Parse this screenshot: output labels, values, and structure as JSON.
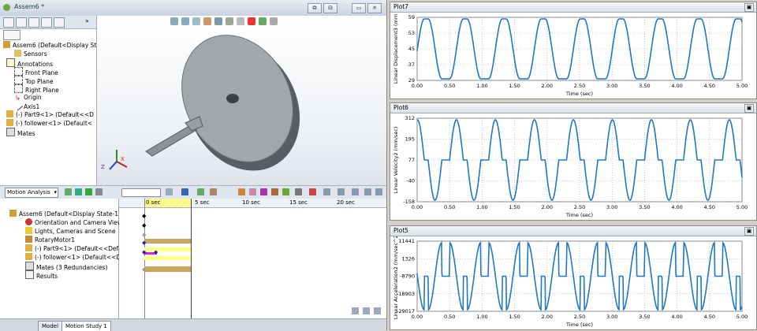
{
  "window": {
    "title": "Assem6 *",
    "btn_restore": "⧉",
    "btn_tile": "⊟",
    "btn_min": "▭",
    "btn_close": "✕",
    "pane_close": "▣"
  },
  "tree": {
    "root": "Assem6  (Default<Display State-",
    "items": [
      "Sensors",
      "Annotations",
      "Front Plane",
      "Top Plane",
      "Right Plane",
      "Origin",
      "Axis1",
      "(-) Part9<1> (Default<<D",
      "(-) follower<1> (Default<",
      "Mates"
    ]
  },
  "motion": {
    "study_type": "Motion Analysis",
    "ruler": [
      "0 sec",
      "5 sec",
      "10 sec",
      "15 sec",
      "20 sec"
    ],
    "tree": [
      "Assem6  (Default<Display State-1",
      "Orientation and Camera Views",
      "Lights, Cameras and Scene",
      "RotaryMotor1",
      "(-) Part9<1> (Default<<Defau",
      "(-) follower<1> (Default<<De",
      "Mates (3 Redundancies)",
      "Results"
    ],
    "tabs": [
      "Model",
      "Motion Study 1"
    ]
  },
  "plots": [
    {
      "title": "Plot7",
      "ylabel": "Linear Displacement3 (mm",
      "xlabel": "Time (sec)",
      "yticks": [
        "29",
        "37",
        "45",
        "53",
        "59"
      ],
      "xticks": [
        "0.00",
        "0.50",
        "1.00",
        "1.50",
        "2.00",
        "2.50",
        "3.00",
        "3.50",
        "4.00",
        "4.50",
        "5.00"
      ]
    },
    {
      "title": "Plot6",
      "ylabel": "Linear Velocity2 (mm/sec)",
      "xlabel": "Time (sec)",
      "yticks": [
        "-158",
        "-40",
        "77",
        "195",
        "312"
      ],
      "xticks": [
        "0.00",
        "0.50",
        "1.00",
        "1.50",
        "2.00",
        "2.50",
        "3.00",
        "3.50",
        "4.00",
        "4.50",
        "5.00"
      ]
    },
    {
      "title": "Plot5",
      "ylabel": "Linear Acceleration2 (mm/sec^2)",
      "xlabel": "Time (sec)",
      "yticks": [
        "-29017",
        "-18903",
        "-8790",
        "1326",
        "11441"
      ],
      "xticks": [
        "0.00",
        "0.50",
        "1.00",
        "1.50",
        "2.00",
        "2.50",
        "3.00",
        "3.50",
        "4.00",
        "4.50",
        "5.00"
      ]
    }
  ],
  "chart_data": [
    {
      "type": "line",
      "title": "Plot7",
      "xlabel": "Time (sec)",
      "ylabel": "Linear Displacement3 (mm",
      "xlim": [
        0,
        5
      ],
      "ylim": [
        29,
        59
      ],
      "grid": true,
      "period": 0.6,
      "shape": "displacement"
    },
    {
      "type": "line",
      "title": "Plot6",
      "xlabel": "Time (sec)",
      "ylabel": "Linear Velocity2 (mm/sec)",
      "xlim": [
        0,
        5
      ],
      "ylim": [
        -158,
        312
      ],
      "grid": true,
      "period": 0.6,
      "shape": "velocity"
    },
    {
      "type": "line",
      "title": "Plot5",
      "xlabel": "Time (sec)",
      "ylabel": "Linear Acceleration2 (mm/sec^2)",
      "xlim": [
        0,
        5
      ],
      "ylim": [
        -29017,
        11441
      ],
      "grid": true,
      "period": 0.6,
      "shape": "acceleration"
    }
  ],
  "colors": {
    "curve": "#1f78c1",
    "grid": "#9aa6b5",
    "timeline_bar": "#c8a85a",
    "timeline_hl": "#ffff80"
  }
}
